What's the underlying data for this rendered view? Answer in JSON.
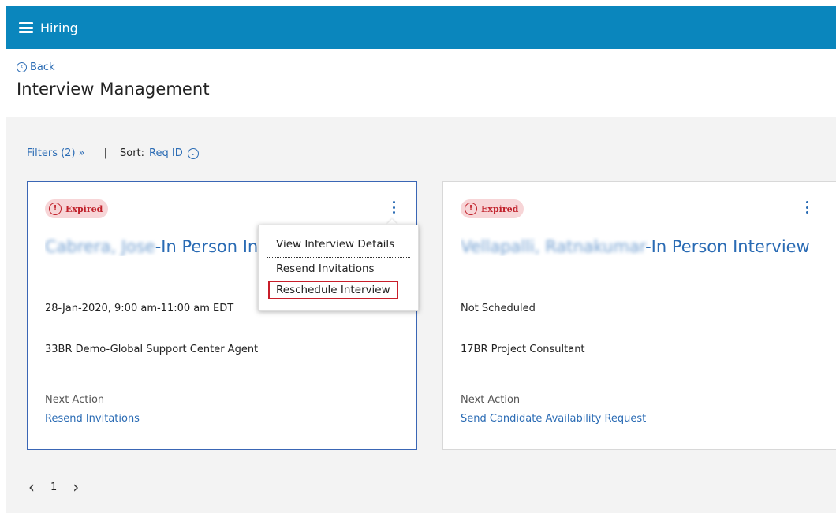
{
  "app": {
    "title": "Hiring"
  },
  "header": {
    "back_label": "Back",
    "page_title": "Interview Management"
  },
  "toolbar": {
    "filters_label": "Filters (2) »",
    "separator": "|",
    "sort_label": "Sort:",
    "sort_value": "Req ID"
  },
  "cards": [
    {
      "status": "Expired",
      "candidate_name": "Cabrera, Jose",
      "title_suffix": "-In Person Int",
      "schedule": "28-Jan-2020, 9:00 am-11:00 am EDT",
      "requisition": "33BR Demo-Global Support Center Agent",
      "next_action_label": "Next Action",
      "next_action": "Resend Invitations"
    },
    {
      "status": "Expired",
      "candidate_name": "Vellapalli, Ratnakumar",
      "title_suffix": "-In Person Interview",
      "schedule": "Not Scheduled",
      "requisition": "17BR Project Consultant",
      "next_action_label": "Next Action",
      "next_action": "Send Candidate Availability Request"
    }
  ],
  "context_menu": {
    "items": [
      "View Interview Details",
      "Resend Invitations",
      "Reschedule Interview"
    ],
    "highlighted": "Reschedule Interview"
  },
  "pagination": {
    "prev": "‹",
    "page": "1",
    "next": "›"
  },
  "colors": {
    "topbar": "#0a86bd",
    "link": "#2a6bb4",
    "expired_bg": "#f7d5d7",
    "expired_text": "#c0202a",
    "highlight_border": "#c81e2a"
  }
}
